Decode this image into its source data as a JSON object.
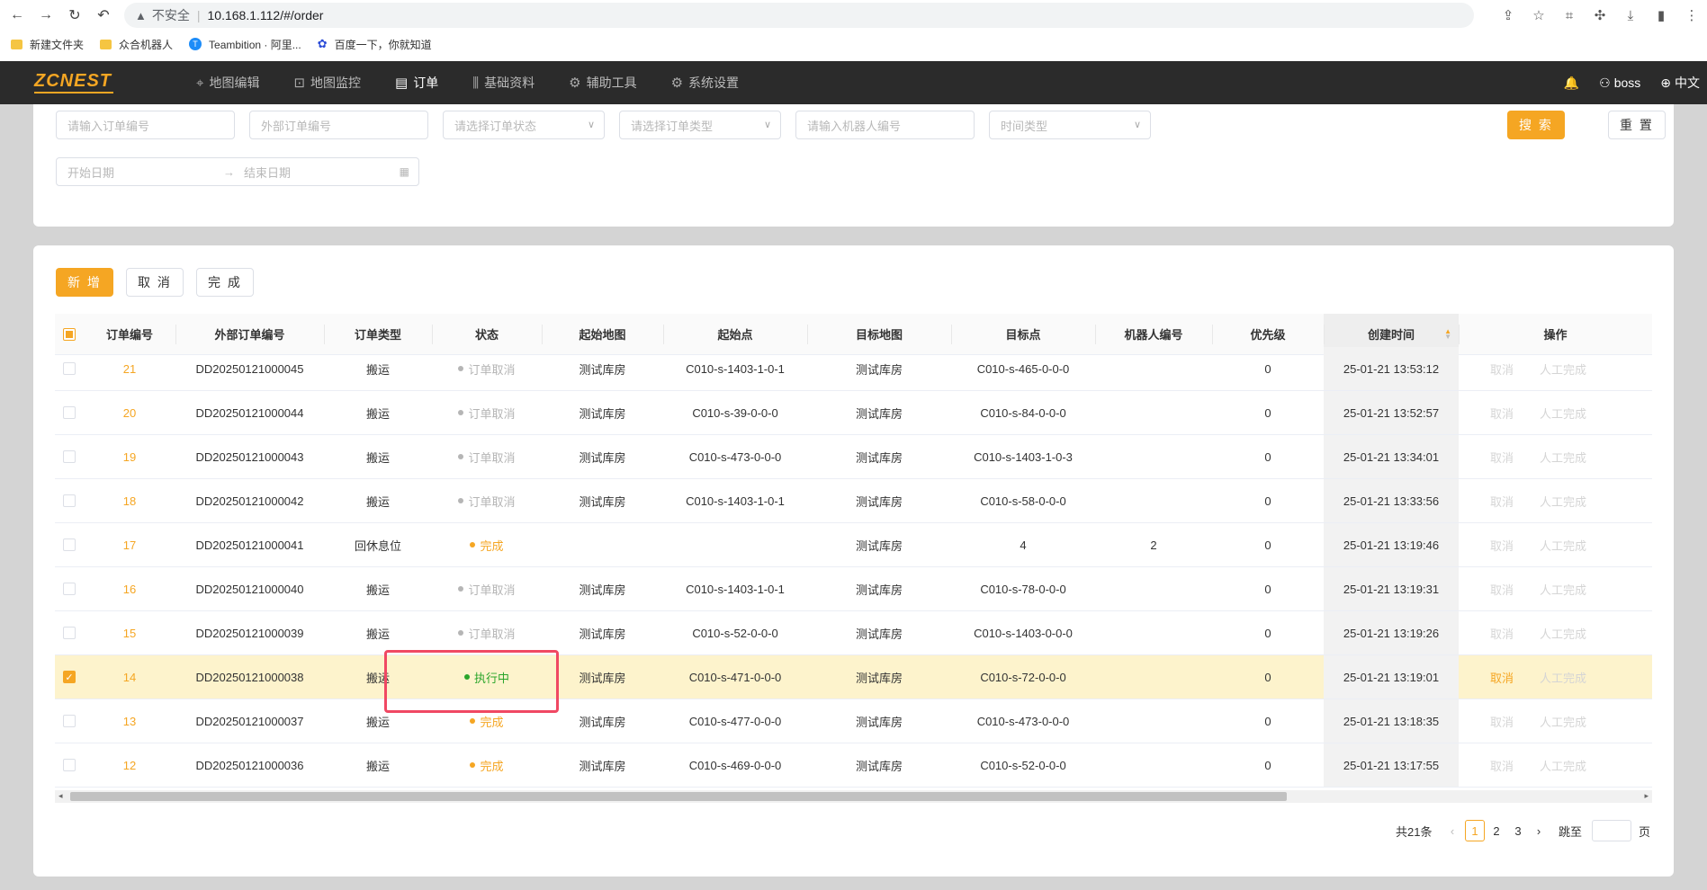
{
  "browser": {
    "security_label": "不安全",
    "url": "10.168.1.112/#/order",
    "bookmarks": [
      {
        "label": "新建文件夹",
        "icon": "folder-icon"
      },
      {
        "label": "众合机器人",
        "icon": "folder-icon"
      },
      {
        "label": "Teambition · 阿里...",
        "icon": "teambition-icon"
      },
      {
        "label": "百度一下，你就知道",
        "icon": "baidu-paw-icon"
      }
    ]
  },
  "app": {
    "logo": "ZCNEST",
    "menu": [
      {
        "label": "地图编辑",
        "icon": "location-pin-icon"
      },
      {
        "label": "地图监控",
        "icon": "monitor-chart-icon"
      },
      {
        "label": "订单",
        "icon": "document-icon",
        "active": true
      },
      {
        "label": "基础资料",
        "icon": "sliders-icon"
      },
      {
        "label": "辅助工具",
        "icon": "gear-icon"
      },
      {
        "label": "系统设置",
        "icon": "gear-icon"
      }
    ],
    "user": "boss",
    "language": "中文"
  },
  "filters": {
    "order_no_placeholder": "请输入订单编号",
    "external_no_placeholder": "外部订单编号",
    "status_placeholder": "请选择订单状态",
    "type_placeholder": "请选择订单类型",
    "robot_placeholder": "请输入机器人编号",
    "time_type_placeholder": "时间类型",
    "start_date_placeholder": "开始日期",
    "end_date_placeholder": "结束日期",
    "search_label": "搜 索",
    "reset_label": "重 置"
  },
  "actions": {
    "add_label": "新 增",
    "cancel_label": "取 消",
    "complete_label": "完 成"
  },
  "table": {
    "headers": [
      "订单编号",
      "外部订单编号",
      "订单类型",
      "状态",
      "起始地图",
      "起始点",
      "目标地图",
      "目标点",
      "机器人编号",
      "优先级",
      "创建时间",
      "操作"
    ],
    "rows": [
      {
        "id": "21",
        "ext": "DD20250121000045",
        "type": "搬运",
        "status": "订单取消",
        "status_kind": "gray",
        "start_map": "测试库房",
        "start_pt": "C010-s-1403-1-0-1",
        "target_map": "测试库房",
        "target_pt": "C010-s-465-0-0-0",
        "robot": "",
        "priority": "0",
        "created": "25-01-21 13:53:12",
        "op_cancel": "取消",
        "op_complete": "人工完成",
        "checked": false
      },
      {
        "id": "20",
        "ext": "DD20250121000044",
        "type": "搬运",
        "status": "订单取消",
        "status_kind": "gray",
        "start_map": "测试库房",
        "start_pt": "C010-s-39-0-0-0",
        "target_map": "测试库房",
        "target_pt": "C010-s-84-0-0-0",
        "robot": "",
        "priority": "0",
        "created": "25-01-21 13:52:57",
        "op_cancel": "取消",
        "op_complete": "人工完成",
        "checked": false
      },
      {
        "id": "19",
        "ext": "DD20250121000043",
        "type": "搬运",
        "status": "订单取消",
        "status_kind": "gray",
        "start_map": "测试库房",
        "start_pt": "C010-s-473-0-0-0",
        "target_map": "测试库房",
        "target_pt": "C010-s-1403-1-0-3",
        "robot": "",
        "priority": "0",
        "created": "25-01-21 13:34:01",
        "op_cancel": "取消",
        "op_complete": "人工完成",
        "checked": false
      },
      {
        "id": "18",
        "ext": "DD20250121000042",
        "type": "搬运",
        "status": "订单取消",
        "status_kind": "gray",
        "start_map": "测试库房",
        "start_pt": "C010-s-1403-1-0-1",
        "target_map": "测试库房",
        "target_pt": "C010-s-58-0-0-0",
        "robot": "",
        "priority": "0",
        "created": "25-01-21 13:33:56",
        "op_cancel": "取消",
        "op_complete": "人工完成",
        "checked": false
      },
      {
        "id": "17",
        "ext": "DD20250121000041",
        "type": "回休息位",
        "status": "完成",
        "status_kind": "orange",
        "start_map": "",
        "start_pt": "",
        "target_map": "测试库房",
        "target_pt": "4",
        "robot": "2",
        "priority": "0",
        "created": "25-01-21 13:19:46",
        "op_cancel": "取消",
        "op_complete": "人工完成",
        "checked": false
      },
      {
        "id": "16",
        "ext": "DD20250121000040",
        "type": "搬运",
        "status": "订单取消",
        "status_kind": "gray",
        "start_map": "测试库房",
        "start_pt": "C010-s-1403-1-0-1",
        "target_map": "测试库房",
        "target_pt": "C010-s-78-0-0-0",
        "robot": "",
        "priority": "0",
        "created": "25-01-21 13:19:31",
        "op_cancel": "取消",
        "op_complete": "人工完成",
        "checked": false
      },
      {
        "id": "15",
        "ext": "DD20250121000039",
        "type": "搬运",
        "status": "订单取消",
        "status_kind": "gray",
        "start_map": "测试库房",
        "start_pt": "C010-s-52-0-0-0",
        "target_map": "测试库房",
        "target_pt": "C010-s-1403-0-0-0",
        "robot": "",
        "priority": "0",
        "created": "25-01-21 13:19:26",
        "op_cancel": "取消",
        "op_complete": "人工完成",
        "checked": false
      },
      {
        "id": "14",
        "ext": "DD20250121000038",
        "type": "搬运",
        "status": "执行中",
        "status_kind": "green",
        "start_map": "测试库房",
        "start_pt": "C010-s-471-0-0-0",
        "target_map": "测试库房",
        "target_pt": "C010-s-72-0-0-0",
        "robot": "",
        "priority": "0",
        "created": "25-01-21 13:19:01",
        "op_cancel": "取消",
        "op_complete": "人工完成",
        "checked": true
      },
      {
        "id": "13",
        "ext": "DD20250121000037",
        "type": "搬运",
        "status": "完成",
        "status_kind": "orange",
        "start_map": "测试库房",
        "start_pt": "C010-s-477-0-0-0",
        "target_map": "测试库房",
        "target_pt": "C010-s-473-0-0-0",
        "robot": "",
        "priority": "0",
        "created": "25-01-21 13:18:35",
        "op_cancel": "取消",
        "op_complete": "人工完成",
        "checked": false
      },
      {
        "id": "12",
        "ext": "DD20250121000036",
        "type": "搬运",
        "status": "完成",
        "status_kind": "orange",
        "start_map": "测试库房",
        "start_pt": "C010-s-469-0-0-0",
        "target_map": "测试库房",
        "target_pt": "C010-s-52-0-0-0",
        "robot": "",
        "priority": "0",
        "created": "25-01-21 13:17:55",
        "op_cancel": "取消",
        "op_complete": "人工完成",
        "checked": false
      }
    ]
  },
  "pagination": {
    "total": "共21条",
    "pages": [
      "1",
      "2",
      "3"
    ],
    "current": "1",
    "jump_label": "跳至",
    "page_unit": "页"
  },
  "colors": {
    "accent": "#f5a623",
    "appbar": "#2b2b2b",
    "running": "#2aa52a",
    "highlight_box": "#f04863",
    "selected_row": "#fdf3cc"
  }
}
